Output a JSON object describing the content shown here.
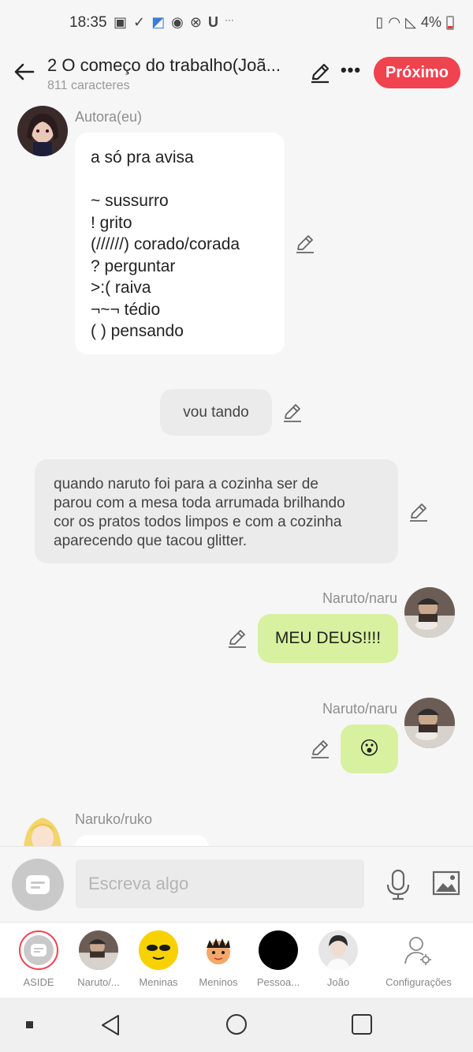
{
  "status": {
    "time": "18:35",
    "battery": "4%"
  },
  "header": {
    "title": "2 O começo do trabalho(Joã...",
    "subtitle": "811 caracteres",
    "next_label": "Próximo"
  },
  "messages": {
    "m1": {
      "speaker": "Autora(eu)",
      "lines": [
        "a só pra avisa",
        "",
        "~ sussurro",
        "! grito",
        "(//////) corado/corada",
        "? perguntar",
        ">:( raiva",
        "¬~¬ tédio",
        "(  ) pensando"
      ]
    },
    "m2": {
      "text": "vou tando"
    },
    "m3": {
      "lines": [
        "quando naruto foi para a cozinha ser de",
        "parou com a mesa toda arrumada brilhando",
        "cor os pratos todos limpos e com a cozinha",
        "aparecendo que tacou glitter."
      ]
    },
    "m4": {
      "speaker": "Naruto/naru",
      "text": "MEU DEUS!!!!"
    },
    "m5": {
      "speaker": "Naruto/naru",
      "text": "😮"
    },
    "m6": {
      "speaker": "Naruko/ruko"
    }
  },
  "input": {
    "placeholder": "Escreva algo"
  },
  "characters": [
    {
      "label": "ASIDE"
    },
    {
      "label": "Naruto/..."
    },
    {
      "label": "Meninas"
    },
    {
      "label": "Meninos"
    },
    {
      "label": "Pessoa..."
    },
    {
      "label": "João"
    },
    {
      "label": "Configurações"
    }
  ],
  "colors": {
    "accent": "#f0424f",
    "bubble_green": "#d7f1a0",
    "bubble_gray": "#ebebeb",
    "background": "#f6f6f6"
  }
}
